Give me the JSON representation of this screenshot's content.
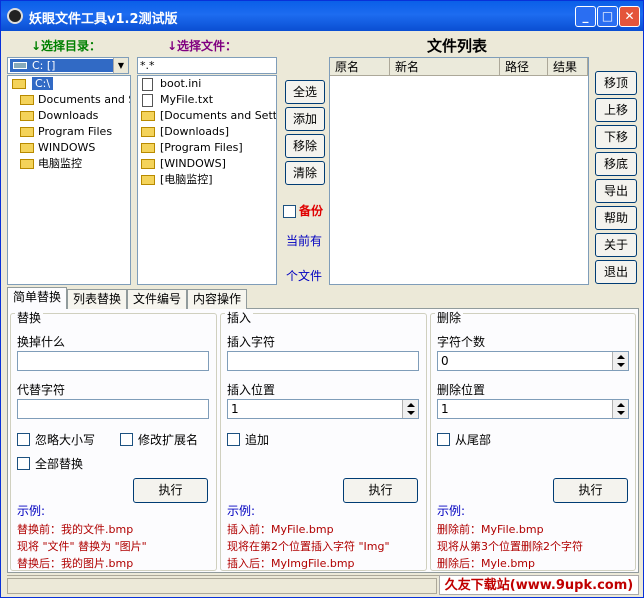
{
  "window": {
    "title": "妖眼文件工具v1.2测试版"
  },
  "dir_panel": {
    "label": "↓选择目录：",
    "drive": "C: []",
    "items": [
      {
        "name": "C:\\",
        "selected": true
      },
      {
        "name": "Documents and Se"
      },
      {
        "name": "Downloads"
      },
      {
        "name": "Program Files"
      },
      {
        "name": "WINDOWS"
      },
      {
        "name": "电脑监控"
      }
    ]
  },
  "file_panel": {
    "label": "↓选择文件：",
    "pattern": "*.*",
    "items": [
      {
        "name": "boot.ini",
        "type": "file"
      },
      {
        "name": "MyFile.txt",
        "type": "file"
      },
      {
        "name": "[Documents and Settings]",
        "type": "folder"
      },
      {
        "name": "[Downloads]",
        "type": "folder"
      },
      {
        "name": "[Program Files]",
        "type": "folder"
      },
      {
        "name": "[WINDOWS]",
        "type": "folder"
      },
      {
        "name": "[电脑监控]",
        "type": "folder"
      }
    ]
  },
  "mid_buttons": [
    "全选",
    "添加",
    "移除",
    "清除"
  ],
  "backup_label": "备份",
  "count_text": {
    "line1": "当前有",
    "line2": "个文件"
  },
  "file_list": {
    "title": "文件列表",
    "columns": [
      "原名",
      "新名",
      "路径",
      "结果"
    ]
  },
  "right_buttons": [
    "移顶",
    "上移",
    "下移",
    "移底",
    "导出",
    "帮助",
    "关于",
    "退出"
  ],
  "tabs": [
    "简单替换",
    "列表替换",
    "文件编号",
    "内容操作"
  ],
  "replace": {
    "group": "替换",
    "what_label": "换掉什么",
    "what_value": "",
    "with_label": "代替字符",
    "with_value": "",
    "ignore_case": "忽略大小写",
    "change_ext": "修改扩展名",
    "replace_all": "全部替换",
    "exec": "执行",
    "ex_title": "示例:",
    "ex1": "替换前：我的文件.bmp",
    "ex2": "现将 \"文件\" 替换为 \"图片\"",
    "ex3": "替换后：我的图片.bmp"
  },
  "insert": {
    "group": "插入",
    "chars_label": "插入字符",
    "chars_value": "",
    "pos_label": "插入位置",
    "pos_value": "1",
    "append": "追加",
    "exec": "执行",
    "ex_title": "示例:",
    "ex1": "插入前：MyFile.bmp",
    "ex2": "现将在第2个位置插入字符 \"Img\"",
    "ex3": "插入后：MyImgFile.bmp"
  },
  "delete": {
    "group": "删除",
    "count_label": "字符个数",
    "count_value": "0",
    "pos_label": "删除位置",
    "pos_value": "1",
    "from_end": "从尾部",
    "exec": "执行",
    "ex_title": "示例:",
    "ex1": "删除前：MyFile.bmp",
    "ex2": "现将从第3个位置删除2个字符",
    "ex3": "删除后：Myle.bmp"
  },
  "watermark": "久友下载站(www.9upk.com)"
}
